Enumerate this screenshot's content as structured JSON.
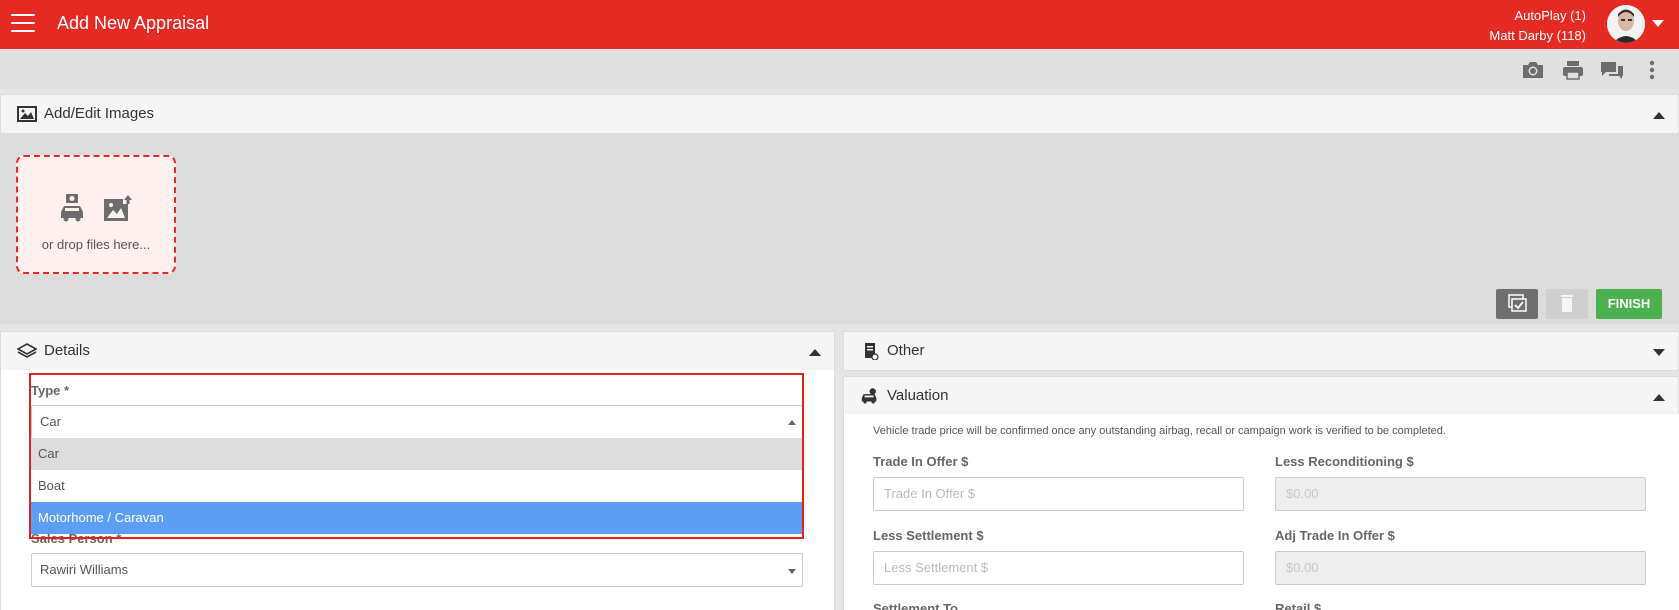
{
  "header": {
    "title": "Add New Appraisal",
    "user_line1": "AutoPlay (1)",
    "user_line2": "Matt Darby (118)",
    "brand_color": "#e52a24"
  },
  "toolbar": {
    "icons": [
      "camera-icon",
      "print-icon",
      "chat-icon",
      "more-vert-icon"
    ]
  },
  "images_panel": {
    "title": "Add/Edit Images",
    "dropzone_text": "or drop files here...",
    "finish_label": "FINISH"
  },
  "details_panel": {
    "title": "Details",
    "type_label": "Type *",
    "type_value": "Car",
    "type_options": [
      "Car",
      "Boat",
      "Motorhome / Caravan"
    ],
    "salesperson_label": "Sales Person *",
    "salesperson_value": "Rawiri Williams"
  },
  "other_panel": {
    "title": "Other"
  },
  "valuation_panel": {
    "title": "Valuation",
    "notice": "Vehicle trade price will be confirmed once any outstanding airbag, recall or campaign work is verified to be completed.",
    "trade_in_label": "Trade In Offer $",
    "trade_in_placeholder": "Trade In Offer $",
    "less_recon_label": "Less Reconditioning $",
    "less_recon_value": "$0.00",
    "less_settlement_label": "Less Settlement $",
    "less_settlement_placeholder": "Less Settlement $",
    "adj_trade_label": "Adj Trade In Offer $",
    "adj_trade_value": "$0.00",
    "settlement_to_label": "Settlement To",
    "retail_label": "Retail $"
  }
}
